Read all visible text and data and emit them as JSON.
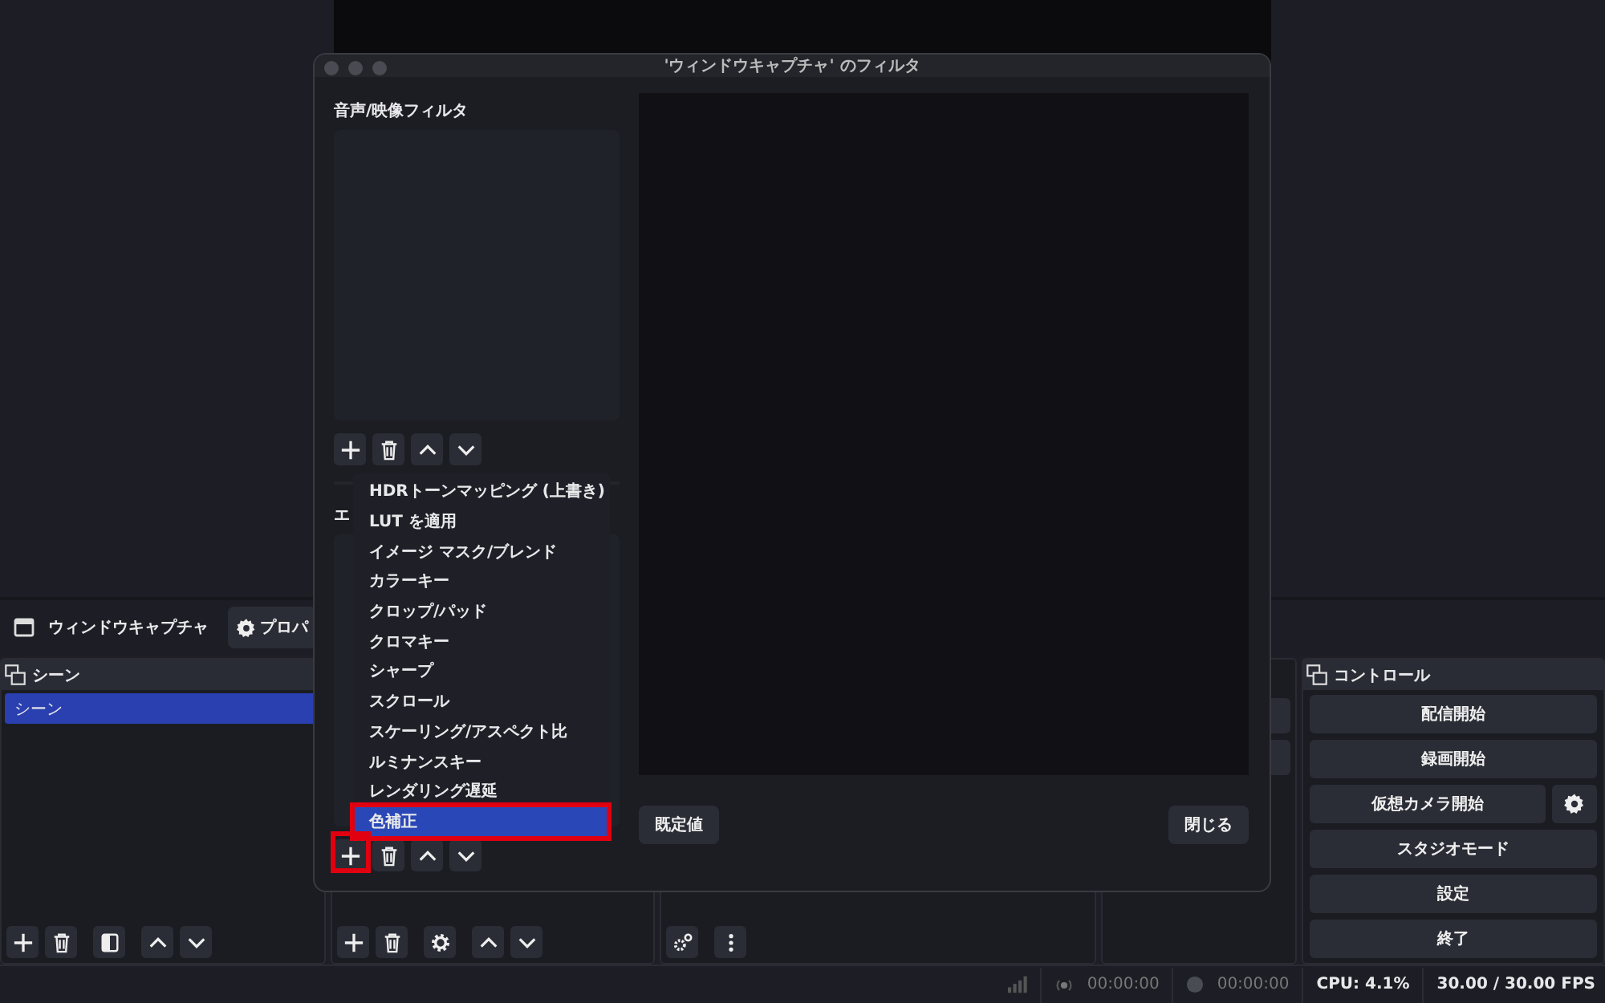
{
  "main": {
    "source_bar": {
      "name": "ウィンドウキャプチャ",
      "properties_button": "プロパ"
    },
    "scenes": {
      "title": "シーン",
      "items": [
        {
          "label": "シーン",
          "selected": true
        }
      ]
    },
    "controls": {
      "title": "コントロール",
      "buttons": [
        {
          "label": "配信開始",
          "has_settings": false
        },
        {
          "label": "録画開始",
          "has_settings": false
        },
        {
          "label": "仮想カメラ開始",
          "has_settings": true
        },
        {
          "label": "スタジオモード",
          "has_settings": false
        },
        {
          "label": "設定",
          "has_settings": false
        },
        {
          "label": "終了",
          "has_settings": false
        }
      ]
    },
    "status_bar": {
      "stream_time": "00:00:00",
      "record_time": "00:00:00",
      "cpu": "CPU: 4.1%",
      "fps": "30.00 / 30.00 FPS"
    }
  },
  "dialog": {
    "title": "'ウィンドウキャプチャ' のフィルタ",
    "av_filters_label": "音声/映像フィルタ",
    "effect_filters_label": "エ",
    "defaults_button": "既定値",
    "close_button": "閉じる"
  },
  "add_menu": {
    "items": [
      {
        "label": "HDRトーンマッピング (上書き)",
        "selected": false
      },
      {
        "label": "LUT を適用",
        "selected": false
      },
      {
        "label": "イメージ マスク/ブレンド",
        "selected": false
      },
      {
        "label": "カラーキー",
        "selected": false
      },
      {
        "label": "クロップ/パッド",
        "selected": false
      },
      {
        "label": "クロマキー",
        "selected": false
      },
      {
        "label": "シャープ",
        "selected": false
      },
      {
        "label": "スクロール",
        "selected": false
      },
      {
        "label": "スケーリング/アスペクト比",
        "selected": false
      },
      {
        "label": "ルミナンスキー",
        "selected": false
      },
      {
        "label": "レンダリング遅延",
        "selected": false
      },
      {
        "label": "色補正",
        "selected": true
      }
    ]
  }
}
